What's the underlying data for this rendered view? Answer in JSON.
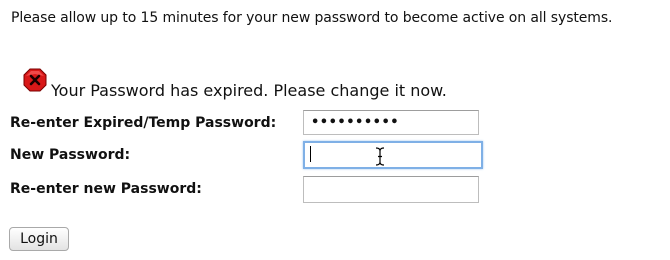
{
  "notice": {
    "text": "Please allow up to 15 minutes for your new password to become active on all systems."
  },
  "status": {
    "icon": "error-x-icon",
    "icon_color": "#d81818",
    "message": "Your Password has expired. Please change it now."
  },
  "form": {
    "expired_password": {
      "label": "Re-enter Expired/Temp Password:",
      "masked_value": "••••••••••"
    },
    "new_password": {
      "label": "New Password:",
      "value": ""
    },
    "confirm_password": {
      "label": "Re-enter new Password:",
      "value": ""
    },
    "submit_label": "Login"
  },
  "colors": {
    "focus_border": "#7fb0e6"
  }
}
